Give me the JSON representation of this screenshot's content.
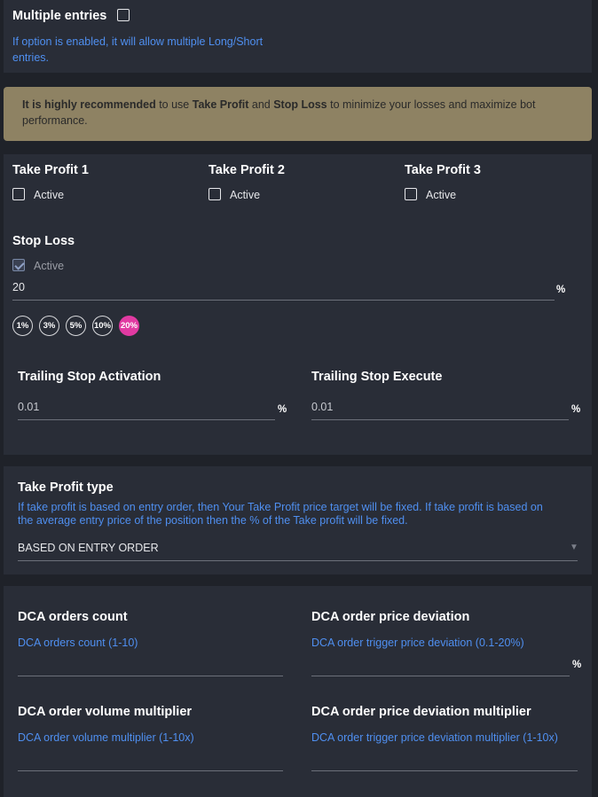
{
  "multiple_entries": {
    "title": "Multiple entries",
    "description_line1": "If option is enabled, it will allow multiple Long/Short",
    "description_line2": "entries."
  },
  "recommendation": {
    "strong1": "It is highly recommended",
    "text1": " to use ",
    "strong2": "Take Profit",
    "text2": " and ",
    "strong3": "Stop Loss",
    "text3": " to minimize your losses and maximize bot",
    "line2": "performance."
  },
  "take_profit": {
    "tp1_title": "Take Profit 1",
    "tp2_title": "Take Profit 2",
    "tp3_title": "Take Profit 3",
    "active_label": "Active"
  },
  "stop_loss": {
    "title": "Stop Loss",
    "active_label": "Active",
    "value": "20",
    "unit": "%",
    "presets": [
      "1%",
      "3%",
      "5%",
      "10%",
      "20%"
    ],
    "selected_preset": "20%"
  },
  "trailing": {
    "activation_title": "Trailing Stop Activation",
    "activation_value": "0.01",
    "activation_unit": "%",
    "execute_title": "Trailing Stop Execute",
    "execute_value": "0.01",
    "execute_unit": "%"
  },
  "take_profit_type": {
    "title": "Take Profit type",
    "description_line1": "If take profit is based on entry order, then Your Take Profit price target will be fixed. If take profit is based on",
    "description_line2": "the average entry price of the position then the % of the Take profit will be fixed.",
    "selected": "BASED ON ENTRY ORDER"
  },
  "dca": {
    "count_title": "DCA orders count",
    "count_hint": "DCA orders count (1-10)",
    "deviation_title": "DCA order price deviation",
    "deviation_hint": "DCA order trigger price deviation (0.1-20%)",
    "deviation_unit": "%",
    "volume_title": "DCA order volume multiplier",
    "volume_hint": "DCA order volume multiplier (1-10x)",
    "dev_mult_title": "DCA order price deviation multiplier",
    "dev_mult_hint": "DCA order trigger price deviation multiplier (1-10x)"
  },
  "colors": {
    "background": "#1f2229",
    "card": "#292d37",
    "banner": "#8e8263",
    "hint_blue": "#4f8ff0",
    "accent_pink": "#e13aa2"
  }
}
